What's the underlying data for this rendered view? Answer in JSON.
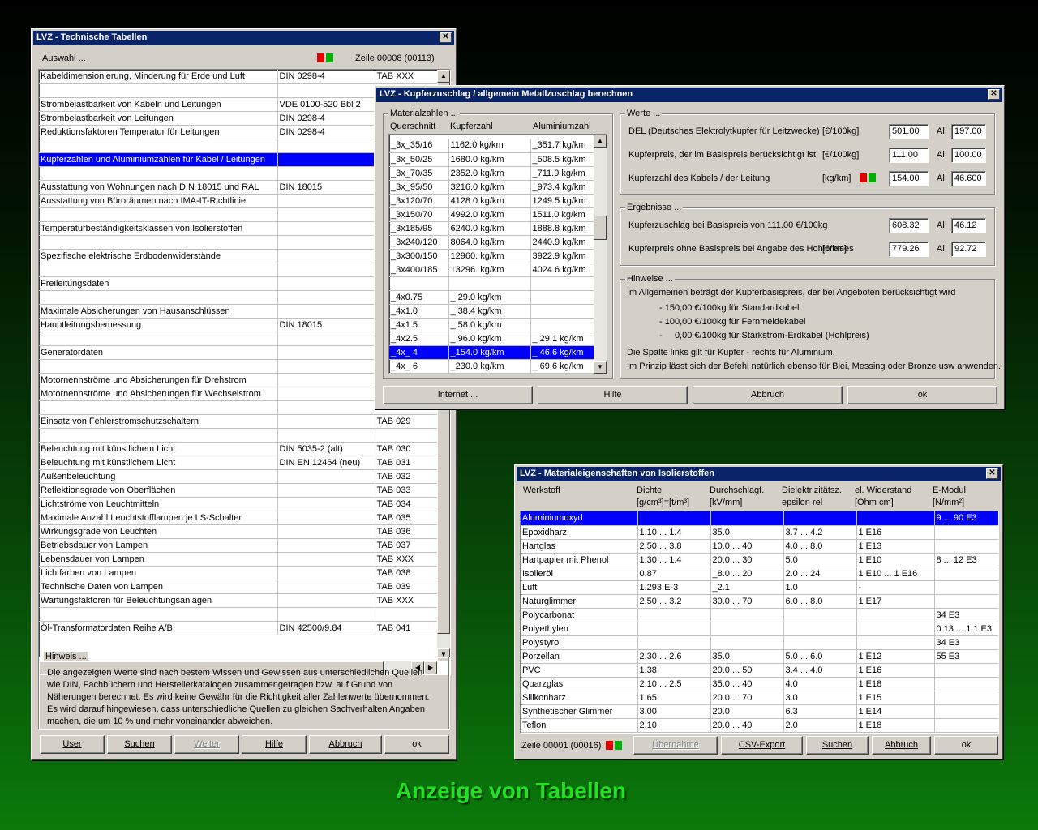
{
  "win1": {
    "title": "LVZ - Technische Tabellen",
    "auswahl": "Auswahl ...",
    "zeile": "Zeile 00008 (00113)",
    "rows": [
      [
        "Kabeldimensionierung, Minderung für Erde und Luft",
        "DIN 0298-4",
        "TAB XXX"
      ],
      [
        "",
        "",
        ""
      ],
      [
        "Strombelastbarkeit von Kabeln und Leitungen",
        "VDE 0100-520 Bbl 2",
        ""
      ],
      [
        "Strombelastbarkeit von Leitungen",
        "DIN 0298-4",
        ""
      ],
      [
        "Reduktionsfaktoren Temperatur für Leitungen",
        "DIN 0298-4",
        ""
      ],
      [
        "",
        "",
        ""
      ],
      [
        "Kupferzahlen und Aluminiumzahlen für Kabel / Leitungen",
        "",
        ""
      ],
      [
        "",
        "",
        ""
      ],
      [
        "Ausstattung von Wohnungen nach DIN 18015 und RAL",
        "DIN 18015",
        ""
      ],
      [
        "Ausstattung von Büroräumen nach IMA-IT-Richtlinie",
        "",
        ""
      ],
      [
        "",
        "",
        ""
      ],
      [
        "Temperaturbeständigkeitsklassen von Isolierstoffen",
        "",
        ""
      ],
      [
        "",
        "",
        ""
      ],
      [
        "Spezifische elektrische Erdbodenwiderstände",
        "",
        ""
      ],
      [
        "",
        "",
        ""
      ],
      [
        "Freileitungsdaten",
        "",
        ""
      ],
      [
        "",
        "",
        ""
      ],
      [
        "Maximale Absicherungen von Hausanschlüssen",
        "",
        ""
      ],
      [
        "Hauptleitungsbemessung",
        "DIN 18015",
        ""
      ],
      [
        "",
        "",
        ""
      ],
      [
        "Generatordaten",
        "",
        ""
      ],
      [
        "",
        "",
        ""
      ],
      [
        "Motornennströme und Absicherungen für Drehstrom",
        "",
        ""
      ],
      [
        "Motornennströme und Absicherungen für Wechselstrom",
        "",
        ""
      ],
      [
        "",
        "",
        ""
      ],
      [
        "Einsatz von Fehlerstromschutzschaltern",
        "",
        "TAB 029"
      ],
      [
        "",
        "",
        ""
      ],
      [
        "Beleuchtung mit künstlichem Licht",
        "DIN 5035-2 (alt)",
        "TAB 030"
      ],
      [
        "Beleuchtung mit künstlichem Licht",
        "DIN EN 12464 (neu)",
        "TAB 031"
      ],
      [
        "Außenbeleuchtung",
        "",
        "TAB 032"
      ],
      [
        "Reflektionsgrade von Oberflächen",
        "",
        "TAB 033"
      ],
      [
        "Lichtströme von Leuchtmitteln",
        "",
        "TAB 034"
      ],
      [
        "Maximale Anzahl Leuchtstofflampen je LS-Schalter",
        "",
        "TAB 035"
      ],
      [
        "Wirkungsgrade von Leuchten",
        "",
        "TAB 036"
      ],
      [
        "Betriebsdauer von Lampen",
        "",
        "TAB 037"
      ],
      [
        "Lebensdauer von Lampen",
        "",
        "TAB XXX"
      ],
      [
        "Lichtfarben von Lampen",
        "",
        "TAB 038"
      ],
      [
        "Technische Daten von Lampen",
        "",
        "TAB 039"
      ],
      [
        "Wartungsfaktoren für Beleuchtungsanlagen",
        "",
        "TAB XXX"
      ],
      [
        "",
        "",
        ""
      ],
      [
        "Öl-Transformatordaten Reihe A/B",
        "DIN 42500/9.84",
        "TAB 041"
      ]
    ],
    "selected_row": 6,
    "hinweis_title": "Hinweis ...",
    "hinweis_text": "Die angezeigten Werte sind nach bestem Wissen und Gewissen aus unterschiedlichen Quellen wie DIN, Fachbüchern und Herstellerkatalogen zusammengetragen bzw. auf Grund von Näherungen berechnet. Es wird keine Gewähr für die Richtigkeit aller Zahlenwerte übernommen. Es wird darauf hingewiesen, dass unterschiedliche Quellen zu gleichen Sachverhalten Angaben machen, die um 10 % und mehr voneinander abweichen.",
    "buttons": {
      "user": "User",
      "suchen": "Suchen",
      "weiter": "Weiter",
      "hilfe": "Hilfe",
      "abbruch": "Abbruch",
      "ok": "ok"
    }
  },
  "win2": {
    "title": "LVZ - Kupferzuschlag / allgemein Metallzuschlag berechnen",
    "materialzahlen_title": "Materialzahlen ...",
    "headers": [
      "Querschnitt",
      "Kupferzahl",
      "Aluminiumzahl"
    ],
    "rows": [
      [
        "_3x_35/16",
        "1162.0 kg/km",
        "_351.7 kg/km"
      ],
      [
        "_3x_50/25",
        "1680.0 kg/km",
        "_508.5 kg/km"
      ],
      [
        "_3x_70/35",
        "2352.0 kg/km",
        "_711.9 kg/km"
      ],
      [
        "_3x_95/50",
        "3216.0 kg/km",
        "_973.4 kg/km"
      ],
      [
        "_3x120/70",
        "4128.0 kg/km",
        "1249.5 kg/km"
      ],
      [
        "_3x150/70",
        "4992.0 kg/km",
        "1511.0 kg/km"
      ],
      [
        "_3x185/95",
        "6240.0 kg/km",
        "1888.8 kg/km"
      ],
      [
        "_3x240/120",
        "8064.0 kg/km",
        "2440.9 kg/km"
      ],
      [
        "_3x300/150",
        "12960. kg/km",
        "3922.9 kg/km"
      ],
      [
        "_3x400/185",
        "13296. kg/km",
        "4024.6 kg/km"
      ],
      [
        "",
        "",
        ""
      ],
      [
        "_4x0.75",
        "_ 29.0 kg/km",
        ""
      ],
      [
        "_4x1.0",
        "_ 38.4 kg/km",
        ""
      ],
      [
        "_4x1.5",
        "_ 58.0 kg/km",
        ""
      ],
      [
        "_4x2.5",
        "_ 96.0 kg/km",
        "_ 29.1 kg/km"
      ],
      [
        "_4x_ 4",
        "_154.0 kg/km",
        "_ 46.6 kg/km"
      ],
      [
        "_4x_ 6",
        "_230.0 kg/km",
        "_ 69.6 kg/km"
      ]
    ],
    "selected_row": 15,
    "werte_title": "Werte ...",
    "werte": [
      {
        "label": "DEL (Deutsches Elektrolytkupfer für Leitzwecke)",
        "unit": "[€/100kg]",
        "cu": "501.00",
        "al_label": "Al",
        "al": "197.00"
      },
      {
        "label": "Kupferpreis, der im Basispreis berücksichtigt ist",
        "unit": "[€/100kg]",
        "cu": "111.00",
        "al_label": "Al",
        "al": "100.00"
      },
      {
        "label": "Kupferzahl des Kabels / der Leitung",
        "unit": "[kg/km]",
        "cu": "154.00",
        "al_label": "Al",
        "al": "46.600"
      }
    ],
    "ergebnisse_title": "Ergebnisse ...",
    "ergebnisse": [
      {
        "label": "Kupferzuschlag bei Basispreis von  111.00  €/100kg",
        "unit": "",
        "cu": "608.32",
        "al_label": "Al",
        "al": "46.12"
      },
      {
        "label": "Kupferpreis ohne Basispreis bei Angabe des Hohlpreises",
        "unit": "[€/km]",
        "cu": "779.26",
        "al_label": "Al",
        "al": "92.72"
      }
    ],
    "hinweise_title": "Hinweise ...",
    "hinweise_lines": [
      "Im Allgemeinen beträgt der Kupferbasispreis, der bei Angeboten berücksichtigt wird",
      "- 150,00 €/100kg für Standardkabel",
      "- 100,00 €/100kg für Fernmeldekabel",
      "-     0,00 €/100kg für Starkstrom-Erdkabel (Hohlpreis)",
      "Die Spalte links gilt für Kupfer - rechts für Aluminium.",
      "Im Prinzip lässt sich der Befehl natürlich ebenso für Blei, Messing oder Bronze usw anwenden."
    ],
    "buttons": {
      "internet": "Internet ...",
      "hilfe": "Hilfe",
      "abbruch": "Abbruch",
      "ok": "ok"
    }
  },
  "win3": {
    "title": "LVZ - Materialeigenschaften von Isolierstoffen",
    "headers": [
      [
        "Werkstoff",
        ""
      ],
      [
        "Dichte",
        "[g/cm³]=[t/m³]"
      ],
      [
        "Durchschlagf.",
        "[kV/mm]"
      ],
      [
        "Dielektrizitätsz.",
        "epsilon rel"
      ],
      [
        "el. Widerstand",
        "[Ohm cm]"
      ],
      [
        "E-Modul",
        "[N/mm²]"
      ]
    ],
    "rows": [
      [
        "Aluminiumoxyd",
        "",
        "",
        "",
        "",
        "9 ... 90 E3"
      ],
      [
        "Epoxidharz",
        "1.10 ... 1.4",
        "35.0",
        "3.7 ... 4.2",
        "1 E16",
        ""
      ],
      [
        "Hartglas",
        "2.50 ... 3.8",
        "10.0 ... 40",
        "4.0 ... 8.0",
        "1 E13",
        ""
      ],
      [
        "Hartpapier mit Phenol",
        "1.30 ... 1.4",
        "20.0 ... 30",
        "5.0",
        "1 E10",
        "8 ... 12 E3"
      ],
      [
        "Isolieröl",
        "0.87",
        "_8.0 ... 20",
        "2.0 ... 24",
        "1 E10 ... 1 E16",
        ""
      ],
      [
        "Luft",
        "1.293 E-3",
        "_2.1",
        "1.0",
        "-",
        ""
      ],
      [
        "Naturglimmer",
        "2.50 ... 3.2",
        "30.0 ... 70",
        "6.0 ... 8.0",
        "1 E17",
        ""
      ],
      [
        "Polycarbonat",
        "",
        "",
        "",
        "",
        "34 E3"
      ],
      [
        "Polyethylen",
        "",
        "",
        "",
        "",
        "0.13 ... 1.1 E3"
      ],
      [
        "Polystyrol",
        "",
        "",
        "",
        "",
        "34 E3"
      ],
      [
        "Porzellan",
        "2.30 ... 2.6",
        "35.0",
        "5.0 ... 6.0",
        "1 E12",
        "55 E3"
      ],
      [
        "PVC",
        "1.38",
        "20.0 ... 50",
        "3.4 ... 4.0",
        "1 E16",
        ""
      ],
      [
        "Quarzglas",
        "2.10 ... 2.5",
        "35.0 ... 40",
        "4.0",
        "1 E18",
        ""
      ],
      [
        "Silikonharz",
        "1.65",
        "20.0 ... 70",
        "3.0",
        "1 E15",
        ""
      ],
      [
        "Synthetischer Glimmer",
        "3.00",
        "20.0",
        "6.3",
        "1 E14",
        ""
      ],
      [
        "Teflon",
        "2.10",
        "20.0 ... 40",
        "2.0",
        "1 E18",
        ""
      ]
    ],
    "selected_row": 0,
    "zeile": "Zeile 00001 (00016)",
    "buttons": {
      "uebernahme": "Übernahme",
      "csv": "CSV-Export",
      "suchen": "Suchen",
      "abbruch": "Abbruch",
      "ok": "ok"
    }
  },
  "caption": "Anzeige von Tabellen",
  "colors": {
    "selection": "#0000ff",
    "titlebar": "#0a246a",
    "caption": "#22e022"
  }
}
